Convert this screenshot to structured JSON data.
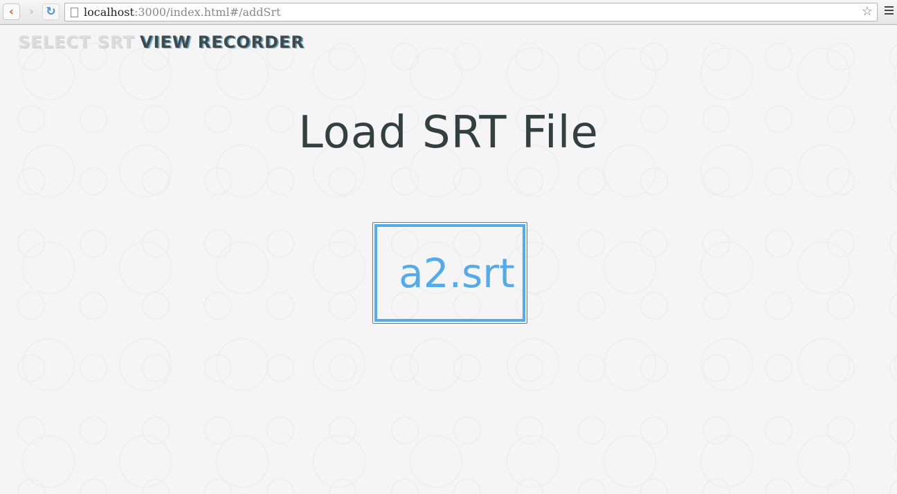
{
  "browser": {
    "url_host": "localhost",
    "url_rest": ":3000/index.html#/addSrt"
  },
  "nav": {
    "select_srt": "SELECT SRT",
    "view_recorder": "VIEW RECORDER"
  },
  "main": {
    "title": "Load SRT File",
    "file_name": "a2.srt"
  },
  "colors": {
    "accent": "#55aaea",
    "title": "#33403f"
  }
}
